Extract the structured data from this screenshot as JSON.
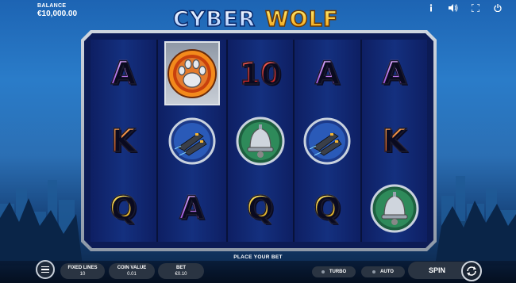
{
  "header": {
    "balance_label": "BALANCE",
    "balance_value": "€10,000.00",
    "logo_text": "CYBER WOLF",
    "icons": [
      "info-icon",
      "sound-icon",
      "fullscreen-icon",
      "power-icon"
    ]
  },
  "reels": [
    [
      "A",
      "K",
      "Q"
    ],
    [
      "wolf-paw-wild",
      "spaceship",
      "A"
    ],
    [
      "10",
      "bell",
      "Q"
    ],
    [
      "A",
      "spaceship",
      "Q"
    ],
    [
      "A",
      "K",
      "bell"
    ]
  ],
  "status": {
    "message": "PLACE YOUR BET"
  },
  "controls": {
    "fixed_lines_label": "FIXED LINES",
    "fixed_lines_value": "10",
    "coin_value_label": "COIN VALUE",
    "coin_value_value": "0.01",
    "bet_label": "BET",
    "bet_value": "€0.10",
    "turbo_label": "TURBO",
    "auto_label": "AUTO",
    "spin_label": "SPIN"
  },
  "colors": {
    "letter_a": "#b466e6",
    "letter_k": "#f07a22",
    "letter_q": "#f4c81c",
    "number_10": "#e8201f",
    "reel_bg": "#14307f"
  }
}
